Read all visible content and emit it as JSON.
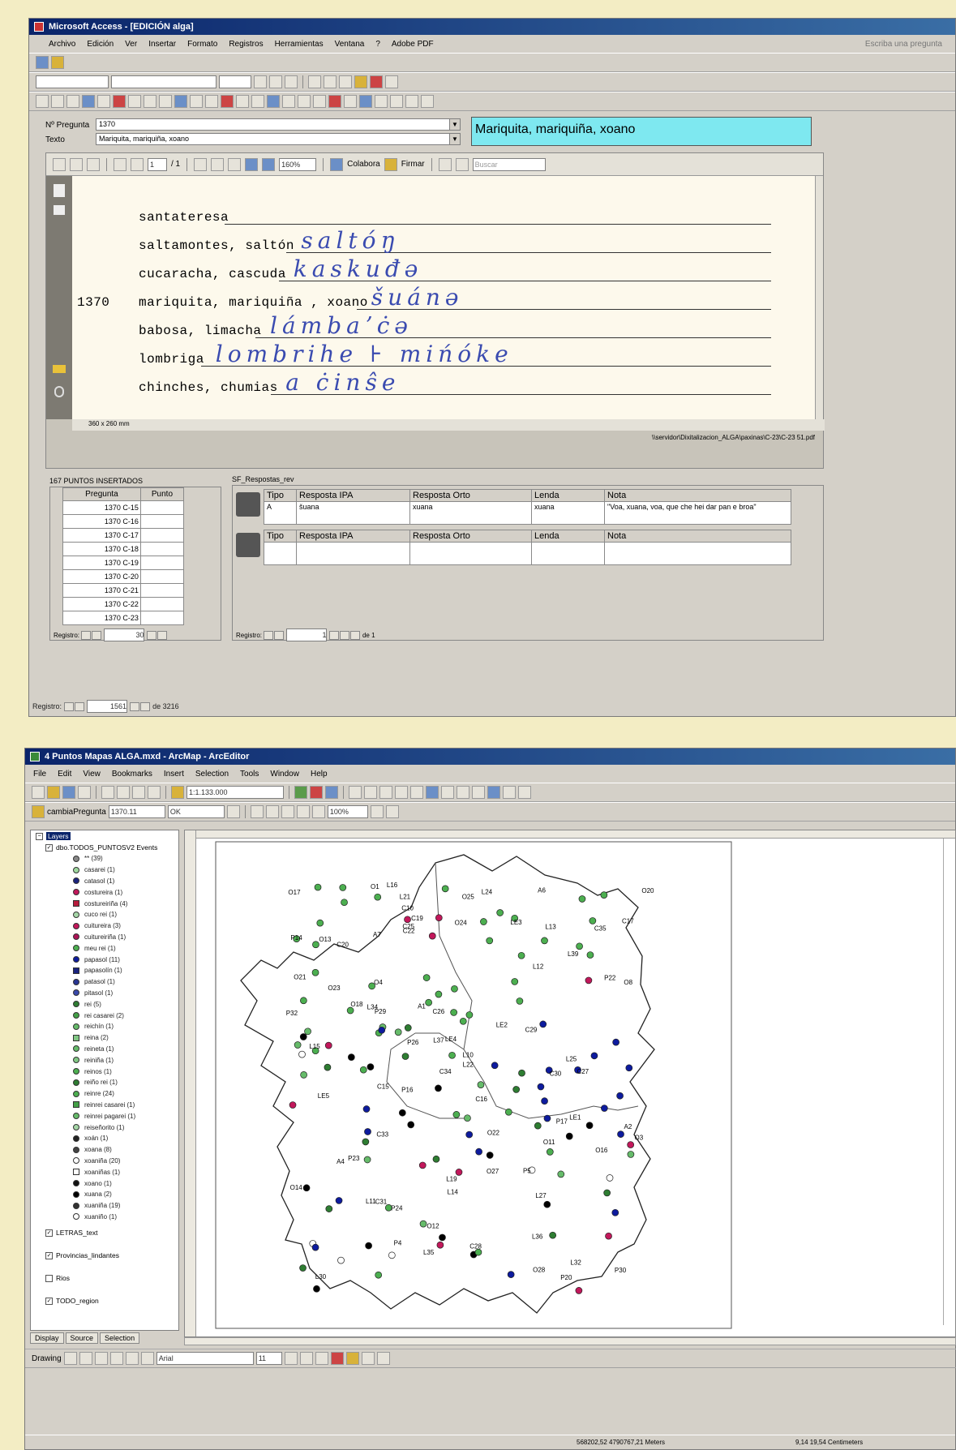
{
  "access": {
    "title": "Microsoft Access - [EDICIÓN alga]",
    "menu": [
      "Archivo",
      "Edición",
      "Ver",
      "Insertar",
      "Formato",
      "Registros",
      "Herramientas",
      "Ventana",
      "?",
      "Adobe PDF"
    ],
    "help_box": "Escriba una pregunta",
    "pregunta_label": "Nº Pregunta",
    "pregunta_value": "1370",
    "texto_label": "Texto",
    "texto_value": "Mariquita, mariquiña, xoano",
    "highlight": "Mariquita, mariquiña, xoano",
    "pdf_toolbar": {
      "page": "1",
      "of": "/ 1",
      "zoom": "160%",
      "colabora": "Colabora",
      "firmar": "Firmar",
      "buscar": "Buscar"
    },
    "page_size": "360 x 260 mm",
    "pdf_path": "\\\\servidor\\Dixitalizacion_ALGA\\paxinas\\C-23\\C-23 51.pdf",
    "doc": {
      "number": "1370",
      "lines": [
        "santateresa",
        "saltamontes, saltón",
        "cucaracha, cascuda",
        "mariquita, mariquiña , xoano",
        "babosa, limacha",
        "lombriga",
        "chinches, chumias"
      ],
      "handwriting": [
        "",
        "saltóŋ",
        "kaskuđə",
        "šuánə",
        "lámbaʼċə",
        "lombrihe  ⊦ mińóke",
        "a ċinŝe"
      ]
    },
    "puntos": {
      "title": "167 PUNTOS INSERTADOS",
      "headers": [
        "Pregunta",
        "Punto"
      ],
      "rows": [
        [
          "1370",
          "C-15"
        ],
        [
          "1370",
          "C-16"
        ],
        [
          "1370",
          "C-17"
        ],
        [
          "1370",
          "C-18"
        ],
        [
          "1370",
          "C-19"
        ],
        [
          "1370",
          "C-20"
        ],
        [
          "1370",
          "C-21"
        ],
        [
          "1370",
          "C-22"
        ],
        [
          "1370",
          "C-23"
        ]
      ],
      "registro_label": "Registro:",
      "registro_total": "30"
    },
    "respostas": {
      "title": "SF_Respostas_rev",
      "headers": [
        "Tipo",
        "Resposta IPA",
        "Resposta Orto",
        "Lenda",
        "Nota"
      ],
      "row": [
        "A",
        "šuana",
        "xuana",
        "xuana",
        "\"Voa, xuana, voa, que che hei dar pan e broa\""
      ],
      "registro_label": "Registro:",
      "registro_value": "1",
      "registro_of": "de 1"
    },
    "bottom_registro_label": "Registro:",
    "bottom_registro_value": "1561",
    "bottom_registro_of": "de 3216"
  },
  "arcmap": {
    "title": "4 Puntos Mapas ALGA.mxd - ArcMap - ArcEditor",
    "menu": [
      "File",
      "Edit",
      "View",
      "Bookmarks",
      "Insert",
      "Selection",
      "Tools",
      "Window",
      "Help"
    ],
    "scale": "1:1.133.000",
    "cambia_label": "cambiaPregunta",
    "cambia_value": "1370.11",
    "cambia_ok": "OK",
    "zoom": "100%",
    "layers_root": "Layers",
    "layer_event": "dbo.TODOS_PUNTOSV2 Events",
    "legend": [
      {
        "label": "** (39)",
        "color": "#888"
      },
      {
        "label": "casarei (1)",
        "color": "#9ed99e"
      },
      {
        "label": "catasol (1)",
        "color": "#1a237e"
      },
      {
        "label": "costureira (1)",
        "color": "#c2185b"
      },
      {
        "label": "costureiriña (4)",
        "color": "#b71c3c"
      },
      {
        "label": "cuco rei (1)",
        "color": "#a5d6a7"
      },
      {
        "label": "cuitureira (3)",
        "color": "#c2185b"
      },
      {
        "label": "cuitureiriña (1)",
        "color": "#ad1457"
      },
      {
        "label": "meu rei (1)",
        "color": "#4caf50"
      },
      {
        "label": "papasol (11)",
        "color": "#0d1b9e"
      },
      {
        "label": "papasolín (1)",
        "color": "#1a237e"
      },
      {
        "label": "patasol (1)",
        "color": "#283593"
      },
      {
        "label": "pitasol (1)",
        "color": "#3949ab"
      },
      {
        "label": "rei (5)",
        "color": "#2e7d32"
      },
      {
        "label": "rei casarei (2)",
        "color": "#43a047"
      },
      {
        "label": "reichín (1)",
        "color": "#66bb6a"
      },
      {
        "label": "reina (2)",
        "color": "#81c784"
      },
      {
        "label": "reineta (1)",
        "color": "#66bb6a"
      },
      {
        "label": "reiniña (1)",
        "color": "#81c784"
      },
      {
        "label": "reinos (1)",
        "color": "#4caf50"
      },
      {
        "label": "reiño rei (1)",
        "color": "#2e7d32"
      },
      {
        "label": "reinre (24)",
        "color": "#4caf50"
      },
      {
        "label": "reinrei casarei (1)",
        "color": "#43a047"
      },
      {
        "label": "reinrei pagarei (1)",
        "color": "#66bb6a"
      },
      {
        "label": "reiseñorito (1)",
        "color": "#a5d6a7"
      },
      {
        "label": "xoán (1)",
        "color": "#222"
      },
      {
        "label": "xoana (8)",
        "color": "#444"
      },
      {
        "label": "xoaniña (20)",
        "color": "#fff"
      },
      {
        "label": "xoaniñas (1)",
        "color": "#fff"
      },
      {
        "label": "xoano (1)",
        "color": "#111"
      },
      {
        "label": "xuana (2)",
        "color": "#000"
      },
      {
        "label": "xuaniña (19)",
        "color": "#333"
      },
      {
        "label": "xuaniño (1)",
        "color": "#fff"
      }
    ],
    "other_layers": [
      "LETRAS_text",
      "Provincias_lindantes",
      "Rios",
      "TODO_region"
    ],
    "tabs": [
      "Display",
      "Source",
      "Selection"
    ],
    "drawing_label": "Drawing",
    "font_name": "Arial",
    "font_size": "11",
    "coords": "568202,52  4790767,21 Meters",
    "page_coords": "9,14  19,54 Centimeters",
    "map_labels": [
      "A1",
      "A2",
      "A4",
      "A6",
      "A7",
      "C10",
      "C15",
      "C16",
      "C17",
      "C19",
      "C20",
      "C22",
      "C25",
      "C26",
      "C27",
      "C28",
      "C29",
      "C30",
      "C31",
      "C33",
      "C34",
      "C35",
      "L10",
      "L11",
      "L12",
      "L13",
      "L14",
      "L15",
      "L16",
      "L19",
      "L21",
      "L22",
      "L24",
      "L25",
      "L27",
      "L30",
      "L32",
      "L34",
      "L35",
      "L36",
      "L37",
      "L39",
      "LE1",
      "LE2",
      "LE3",
      "LE4",
      "LE5",
      "O1",
      "O3",
      "O4",
      "O8",
      "O11",
      "O12",
      "O13",
      "O14",
      "O16",
      "O17",
      "O18",
      "O20",
      "O21",
      "O22",
      "O23",
      "O24",
      "O25",
      "O27",
      "O28",
      "P4",
      "P5",
      "P14",
      "P16",
      "P17",
      "P20",
      "P22",
      "P23",
      "P24",
      "P26",
      "P29",
      "P30",
      "P32"
    ]
  }
}
